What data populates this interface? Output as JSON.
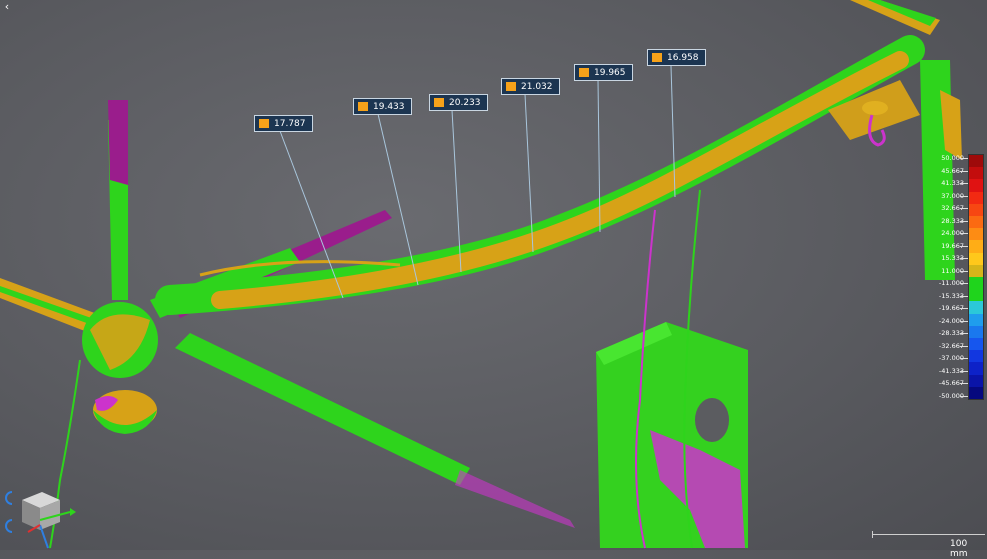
{
  "callouts": [
    {
      "value": "17.787"
    },
    {
      "value": "19.433"
    },
    {
      "value": "20.233"
    },
    {
      "value": "21.032"
    },
    {
      "value": "19.965"
    },
    {
      "value": "16.958"
    }
  ],
  "legend": {
    "labels": [
      "50.000",
      "45.667",
      "41.333",
      "37.000",
      "32.667",
      "28.333",
      "24.000",
      "19.667",
      "15.333",
      "11.000",
      "-11.000",
      "-15.333",
      "-19.667",
      "-24.000",
      "-28.333",
      "-32.667",
      "-37.000",
      "-41.333",
      "-45.667",
      "-50.000"
    ],
    "colors": [
      "#9e0a0a",
      "#c30d0d",
      "#e01212",
      "#f22a12",
      "#f74712",
      "#fb6a12",
      "#fd8c14",
      "#ffad16",
      "#ffc81b",
      "#d6b51a",
      "#1fd41c",
      "#1fd41c",
      "#2bc8d9",
      "#1f9ded",
      "#1a78ee",
      "#1656ee",
      "#1237e0",
      "#0d22c8",
      "#0a14a8",
      "#06097e"
    ]
  },
  "scale_bar": {
    "label": "100 mm"
  },
  "colors": {
    "in_tolerance": "#2ee21c",
    "above": "#d7a217",
    "below": "#cc33cc",
    "callout_bg": "#1c3551",
    "callout_swatch": "#f6a21a"
  },
  "icons": {
    "back": "back-arrow-icon",
    "view_cube": "view-cube-icon",
    "rotate": "rotate-icon"
  }
}
